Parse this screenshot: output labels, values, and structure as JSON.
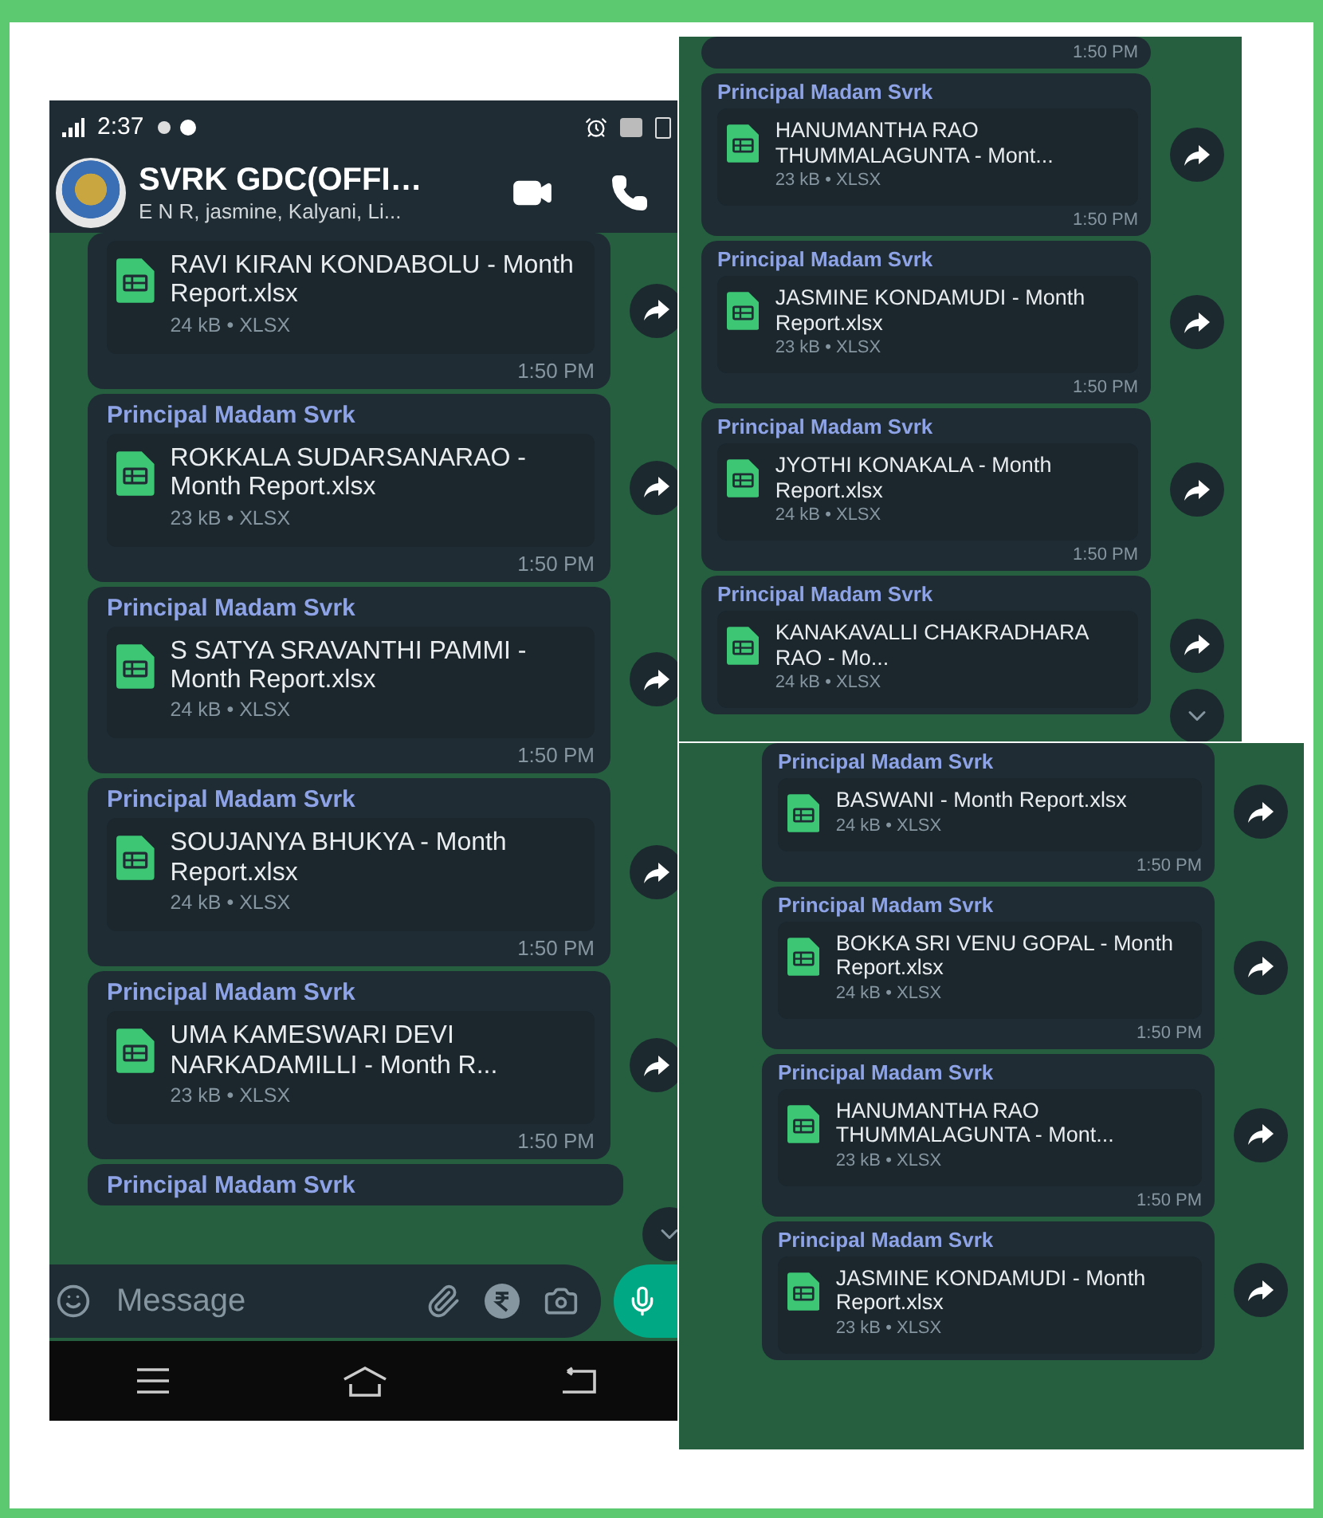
{
  "screenshots": [
    {
      "status_bar": {
        "time": "2:37"
      },
      "header": {
        "title": "SVRK GDC(OFFI…",
        "subtitle": "E N R, jasmine, Kalyani, Li..."
      },
      "messages": [
        {
          "file": "RAVI KIRAN KONDABOLU - Month Report.xlsx",
          "meta": "24 kB • XLSX",
          "time": "1:50 PM"
        },
        {
          "sender": "Principal Madam Svrk",
          "file": "ROKKALA SUDARSANARAO - Month Report.xlsx",
          "meta": "23 kB • XLSX",
          "time": "1:50 PM"
        },
        {
          "sender": "Principal Madam Svrk",
          "file": "S SATYA SRAVANTHI PAMMI - Month Report.xlsx",
          "meta": "24 kB • XLSX",
          "time": "1:50 PM"
        },
        {
          "sender": "Principal Madam Svrk",
          "file": "SOUJANYA BHUKYA - Month Report.xlsx",
          "meta": "24 kB • XLSX",
          "time": "1:50 PM"
        },
        {
          "sender": "Principal Madam Svrk",
          "file": "UMA KAMESWARI DEVI NARKADAMILLI - Month R...",
          "meta": "23 kB • XLSX",
          "time": "1:50 PM"
        },
        {
          "sender": "Principal Madam Svrk"
        }
      ],
      "scroll_down_button": true,
      "composer": {
        "placeholder": "Message"
      },
      "nav_bar": true
    },
    {
      "messages": [
        {
          "time": "1:50 PM"
        },
        {
          "sender": "Principal Madam Svrk",
          "file": "HANUMANTHA RAO THUMMALAGUNTA - Mont...",
          "meta": "23 kB • XLSX",
          "time": "1:50 PM"
        },
        {
          "sender": "Principal Madam Svrk",
          "file": "JASMINE KONDAMUDI - Month Report.xlsx",
          "meta": "23 kB • XLSX",
          "time": "1:50 PM"
        },
        {
          "sender": "Principal Madam Svrk",
          "file": "JYOTHI KONAKALA - Month Report.xlsx",
          "meta": "24 kB • XLSX",
          "time": "1:50 PM"
        },
        {
          "sender": "Principal Madam Svrk",
          "file": "KANAKAVALLI CHAKRADHARA RAO - Mo...",
          "meta": "24 kB • XLSX"
        }
      ],
      "scroll_down_button": true
    },
    {
      "messages": [
        {
          "sender": "Principal Madam Svrk",
          "file": "BASWANI - Month Report.xlsx",
          "meta": "24 kB • XLSX",
          "time": "1:50 PM"
        },
        {
          "sender": "Principal Madam Svrk",
          "file": "BOKKA SRI VENU GOPAL - Month Report.xlsx",
          "meta": "24 kB • XLSX",
          "time": "1:50 PM"
        },
        {
          "sender": "Principal Madam Svrk",
          "file": "HANUMANTHA RAO THUMMALAGUNTA - Mont...",
          "meta": "23 kB • XLSX",
          "time": "1:50 PM"
        },
        {
          "sender": "Principal Madam Svrk",
          "file": "JASMINE KONDAMUDI - Month Report.xlsx",
          "meta": "23 kB • XLSX"
        }
      ]
    }
  ]
}
